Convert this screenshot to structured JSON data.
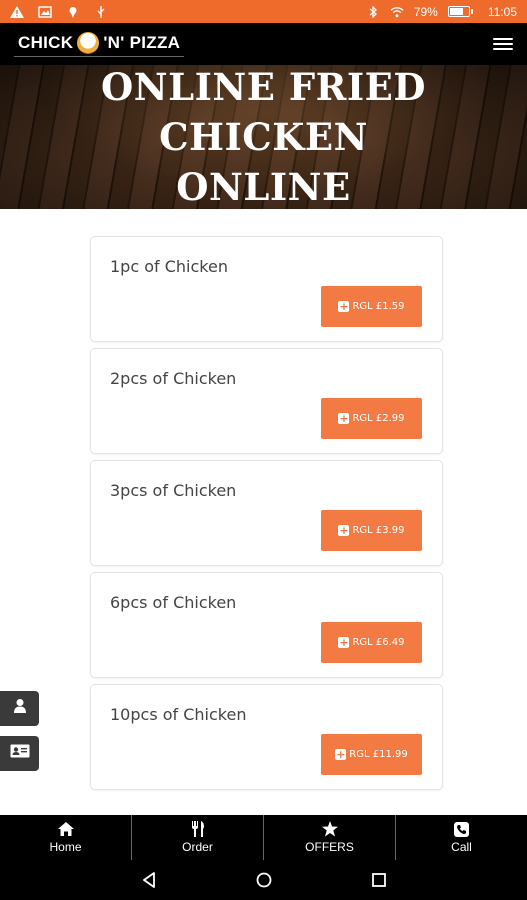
{
  "status_bar": {
    "battery_percent": "79%",
    "battery_level": 0.79,
    "time": "11:05",
    "background_color": "#ef6b2c"
  },
  "header": {
    "logo_text_left": "CHICK",
    "logo_text_right": "'N' PIZZA",
    "menu_icon": "hamburger-icon"
  },
  "hero": {
    "title_line1": "ONLINE FRIED CHICKEN",
    "title_line2": "ONLINE"
  },
  "menu": {
    "items": [
      {
        "name": "1pc of Chicken",
        "price_label": "RGL £1.59"
      },
      {
        "name": "2pcs of Chicken",
        "price_label": "RGL £2.99"
      },
      {
        "name": "3pcs of Chicken",
        "price_label": "RGL £3.99"
      },
      {
        "name": "6pcs of Chicken",
        "price_label": "RGL £6.49"
      },
      {
        "name": "10pcs of Chicken",
        "price_label": "RGL £11.99"
      }
    ],
    "button_color": "#f47a43"
  },
  "side_buttons": {
    "user_icon": "user-icon",
    "contact_icon": "contact-card-icon"
  },
  "bottom_nav": {
    "items": [
      {
        "label": "Home",
        "icon": "home-icon"
      },
      {
        "label": "Order",
        "icon": "cutlery-icon"
      },
      {
        "label": "OFFERS",
        "icon": "star-icon"
      },
      {
        "label": "Call",
        "icon": "phone-icon"
      }
    ]
  }
}
